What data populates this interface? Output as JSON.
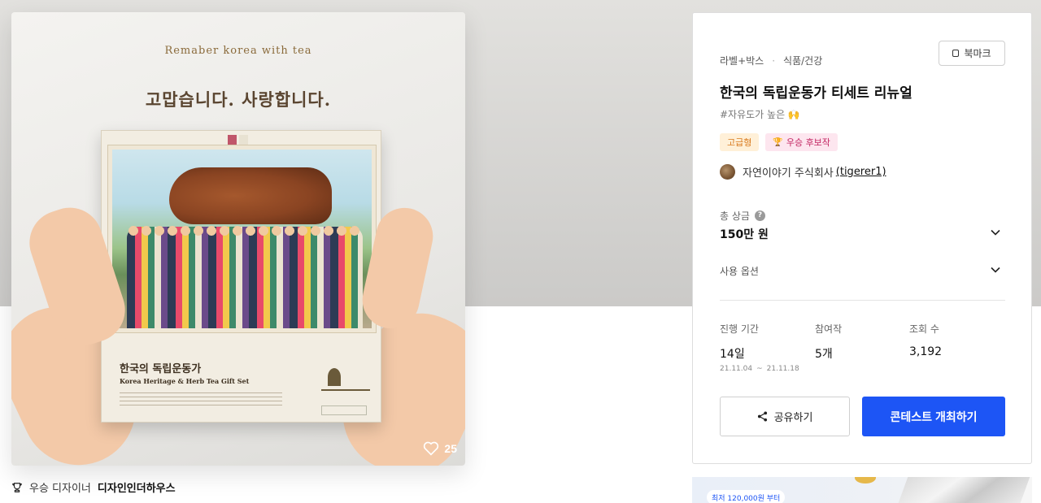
{
  "hero": {
    "arc_text": "Remaber korea with tea",
    "headline": "고맙습니다. 사랑합니다.",
    "box_title_ko": "한국의 독립운동가",
    "box_title_en": "Korea Heritage & Herb Tea Gift Set",
    "likes": "25"
  },
  "winner": {
    "prefix": "우승 디자이너",
    "name": "디자인인더하우스"
  },
  "panel": {
    "categories": [
      "라벨+박스",
      "식품/건강"
    ],
    "bookmark_label": "북마크",
    "title": "한국의 독립운동가 티세트 리뉴얼",
    "tagline": "#자유도가 높은 🙌",
    "badges": {
      "premium": "고급형",
      "candidate": "우승 후보작"
    },
    "host": {
      "company": "자연이야기 주식회사",
      "user_id": "(tigerer1)"
    },
    "prize": {
      "label": "총 상금",
      "value": "150만 원"
    },
    "options_label": "사용 옵션",
    "stats": {
      "period": {
        "label": "진행 기간",
        "value": "14일",
        "start": "21.11.04",
        "sep": "~",
        "end": "21.11.18"
      },
      "entries": {
        "label": "참여작",
        "value": "5개"
      },
      "views": {
        "label": "조회 수",
        "value": "3,192"
      }
    },
    "share_label": "공유하기",
    "host_contest_label": "콘테스트 개최하기"
  },
  "promo": {
    "pill": "최저 120,000원 부터"
  },
  "colors": {
    "primary": "#1d55f5",
    "premium_badge_bg": "#fff0d8",
    "premium_badge_fg": "#d8791d",
    "candidate_badge_bg": "#fde6ef",
    "candidate_badge_fg": "#c22461"
  }
}
